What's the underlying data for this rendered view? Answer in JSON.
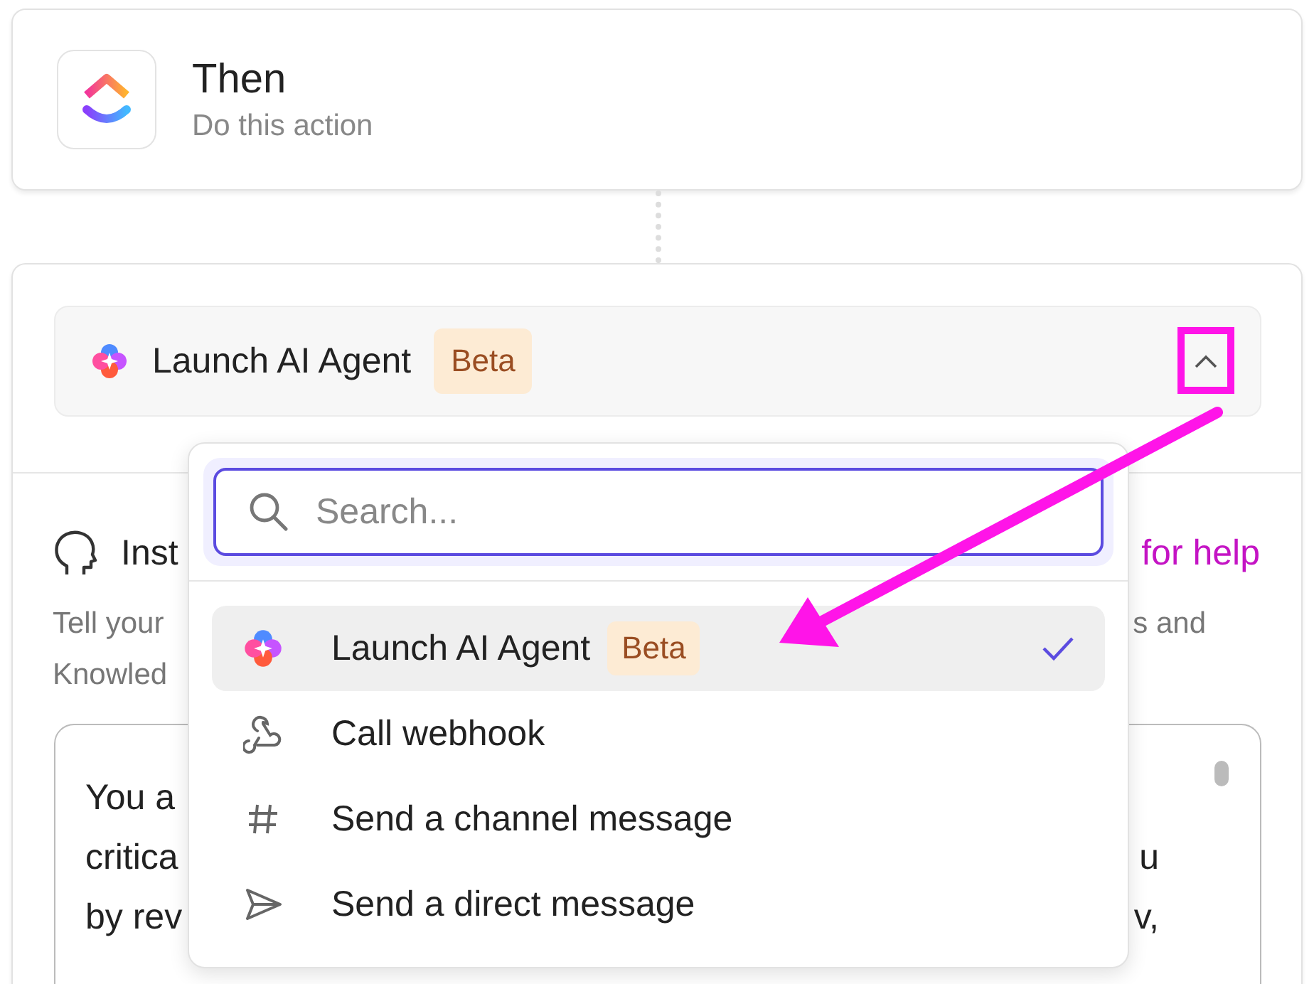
{
  "header_card": {
    "title": "Then",
    "subtitle": "Do this action"
  },
  "action_select": {
    "label": "Launch AI Agent",
    "badge": "Beta",
    "expanded": true
  },
  "instructions": {
    "heading": "Inst",
    "help_link": "for help",
    "description_lines": [
      {
        "left": "Tell your",
        "right": "s and"
      },
      {
        "left": "Knowled"
      }
    ],
    "prompt_lines": [
      {
        "left": "You a"
      },
      {
        "left": "critica",
        "right": "u"
      },
      {
        "left": "by rev",
        "right": "v,"
      }
    ]
  },
  "dropdown": {
    "search_placeholder": "Search...",
    "items": [
      {
        "kind": "agent",
        "label": "Launch AI Agent",
        "badge": "Beta",
        "selected": true
      },
      {
        "kind": "webhook",
        "label": "Call webhook",
        "selected": false
      },
      {
        "kind": "channel",
        "label": "Send a channel message",
        "selected": false
      },
      {
        "kind": "direct",
        "label": "Send a direct message",
        "selected": false
      }
    ]
  },
  "annotation": {
    "highlight_box": true,
    "arrow": true
  }
}
